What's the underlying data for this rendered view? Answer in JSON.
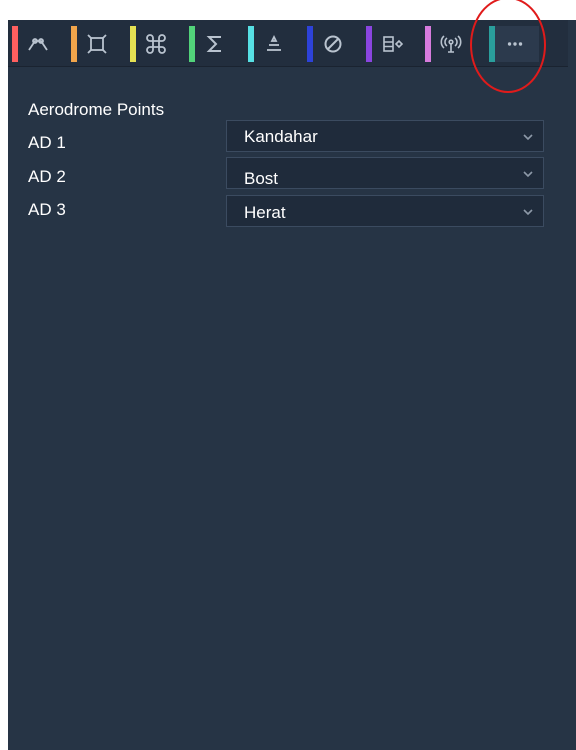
{
  "toolbar": {
    "tools": [
      {
        "icon": "curve-tool-icon",
        "color": "#ff5f5f"
      },
      {
        "icon": "bounding-box-icon",
        "color": "#f1a54b"
      },
      {
        "icon": "command-icon",
        "color": "#e5e153"
      },
      {
        "icon": "sigma-icon",
        "color": "#52d37a"
      },
      {
        "icon": "stack-icon",
        "color": "#57e0e4"
      },
      {
        "icon": "no-entry-icon",
        "color": "#2d42d8"
      },
      {
        "icon": "database-export-icon",
        "color": "#8a45e0"
      },
      {
        "icon": "antenna-icon",
        "color": "#d77bdd"
      },
      {
        "icon": "more-options-icon",
        "color": "#2a9e9c"
      }
    ]
  },
  "section": {
    "title": "Aerodrome Points"
  },
  "rows": [
    {
      "label": "AD 1",
      "value": "Kandahar"
    },
    {
      "label": "AD 2",
      "value": "Bost"
    },
    {
      "label": "AD 3",
      "value": "Herat"
    }
  ],
  "annotation": {
    "color": "#e01b1b"
  }
}
